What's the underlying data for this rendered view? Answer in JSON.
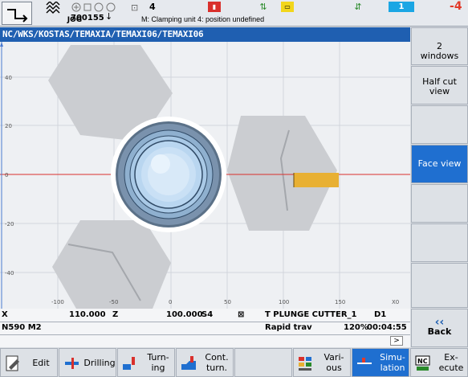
{
  "status": {
    "mode_label": "JOG",
    "program_number": "700155",
    "channel_count": "4",
    "message": "M: Clamping unit 4: position undefined",
    "channel_badge": "1",
    "alarm_count": "4"
  },
  "path": "NC/WKS/KOSTAS/TEMAXIA/TEMAXI06/TEMAXI06",
  "graph": {
    "y_ticks": [
      "40",
      "20",
      "0",
      "-20",
      "-40"
    ],
    "x_ticks": [
      "-100",
      "-50",
      "0",
      "50",
      "100",
      "150"
    ],
    "axis_corner": "X0"
  },
  "info": {
    "row1": {
      "axis1": "X",
      "val1": "110.000",
      "axis2": "Z",
      "val2": "100.000",
      "spindle": "S4",
      "tool": "T PLUNGE CUTTER_1",
      "edge": "D1"
    },
    "row2": {
      "block": "N590  M2",
      "feed": "Rapid trav",
      "override": "120%",
      "time": "00:04:55"
    }
  },
  "right_softkeys": [
    {
      "label": "2 windows",
      "active": false
    },
    {
      "label": "Half cut view",
      "active": false
    },
    {
      "label": "",
      "active": false
    },
    {
      "label": "Face view",
      "active": true
    },
    {
      "label": "",
      "active": false
    },
    {
      "label": "",
      "active": false
    },
    {
      "label": "",
      "active": false
    },
    {
      "label": "Back",
      "active": false
    }
  ],
  "bottom_softkeys": [
    {
      "label": "Edit",
      "icon": "edit-icon",
      "active": false
    },
    {
      "label": "Drilling",
      "icon": "drilling-icon",
      "active": false
    },
    {
      "label": "Turn-ing",
      "icon": "turning-icon",
      "active": false
    },
    {
      "label": "Cont. turn.",
      "icon": "contour-turning-icon",
      "active": false
    },
    {
      "label": "",
      "icon": "",
      "active": false
    },
    {
      "label": "Vari-ous",
      "icon": "various-icon",
      "active": false
    },
    {
      "label": "Simu-lation",
      "icon": "simulation-icon",
      "active": true
    },
    {
      "label": "Ex-ecute",
      "icon": "nc-execute-icon",
      "active": false
    }
  ],
  "colors": {
    "header": "#1f5fb1",
    "active_key": "#1f6fd0",
    "axis_red": "#d9302c",
    "tool_orange": "#e8b033"
  }
}
